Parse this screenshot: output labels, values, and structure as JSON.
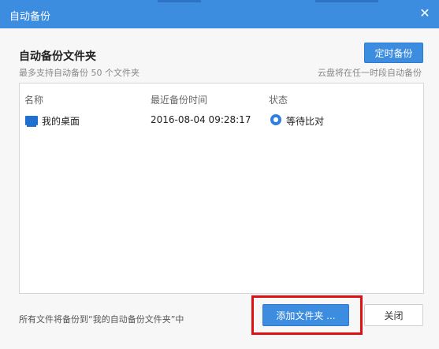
{
  "window": {
    "title": "自动备份"
  },
  "section": {
    "title": "自动备份文件夹",
    "subtitle": "最多支持自动备份 50 个文件夹",
    "hint": "云盘将在任一时段自动备份",
    "schedule_button": "定时备份"
  },
  "table": {
    "headers": [
      "名称",
      "最近备份时间",
      "状态"
    ],
    "rows": [
      {
        "name": "我的桌面",
        "time": "2016-08-04 09:28:17",
        "status": "等待比对",
        "icon": "desktop-folder-icon",
        "status_icon": "waiting-icon"
      }
    ]
  },
  "footer": {
    "note": "所有文件将备份到“我的自动备份文件夹”中",
    "add_button": "添加文件夹 ...",
    "close_button": "关闭"
  },
  "colors": {
    "accent": "#3c8ce0",
    "highlight": "#e01010"
  }
}
